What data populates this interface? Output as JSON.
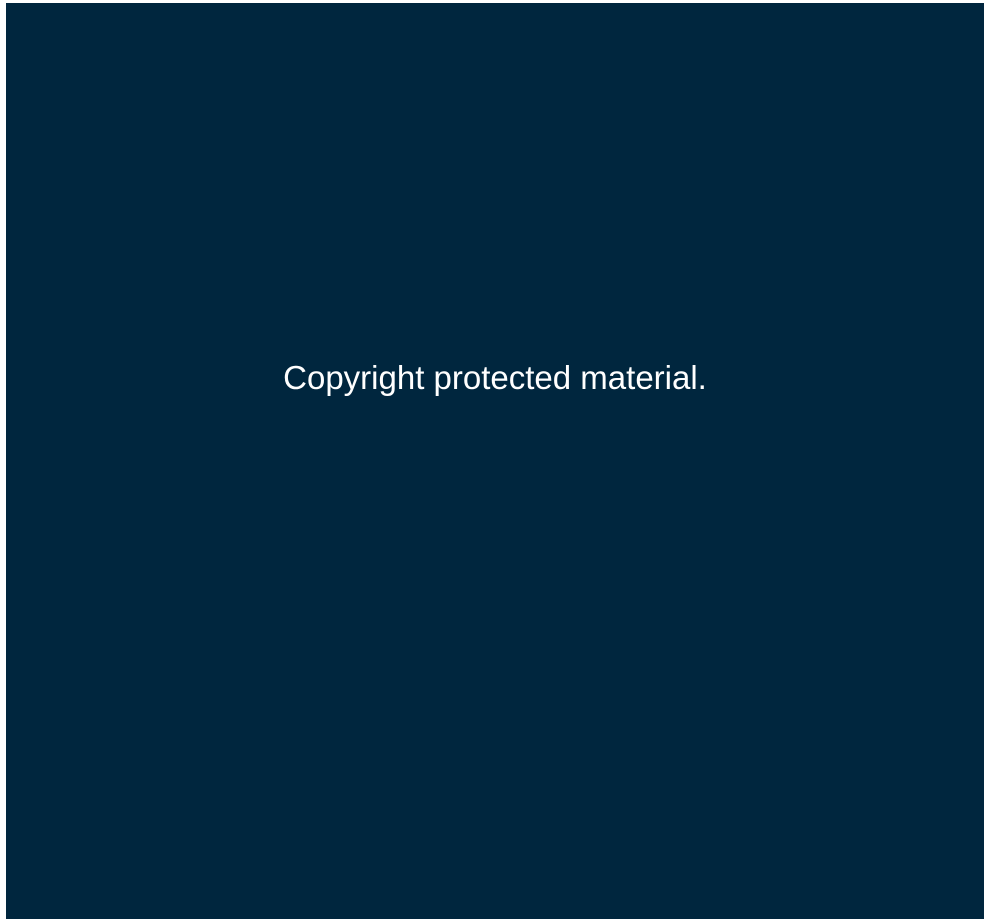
{
  "notice": {
    "text": "Copyright protected material."
  },
  "colors": {
    "background": "#00263e",
    "text": "#ffffff"
  }
}
